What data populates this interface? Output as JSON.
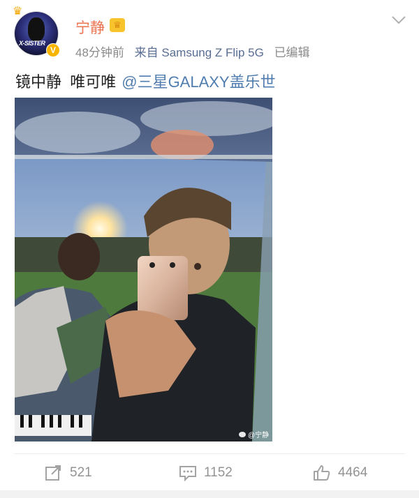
{
  "post": {
    "author": {
      "name": "宁静",
      "avatar_text": "X-SISTER",
      "verified_badge": "V"
    },
    "meta": {
      "time": "48分钟前",
      "source": "来自 Samsung Z Flip 5G",
      "edited": "已编辑"
    },
    "text": "镜中静  唯可唯",
    "mention": "@三星GALAXY盖乐世",
    "image_watermark": "@宁静",
    "actions": {
      "repost_count": "521",
      "comment_count": "1152",
      "like_count": "4464"
    }
  },
  "colors": {
    "username": "#eb7350",
    "link": "#507daf",
    "meta": "#8a8a8a",
    "action": "#939393"
  },
  "icons": [
    "trophy-icon",
    "vip-crown-icon",
    "verified-badge-icon",
    "chevron-down-icon",
    "repost-icon",
    "comment-icon",
    "like-icon",
    "weibo-logo-icon"
  ]
}
